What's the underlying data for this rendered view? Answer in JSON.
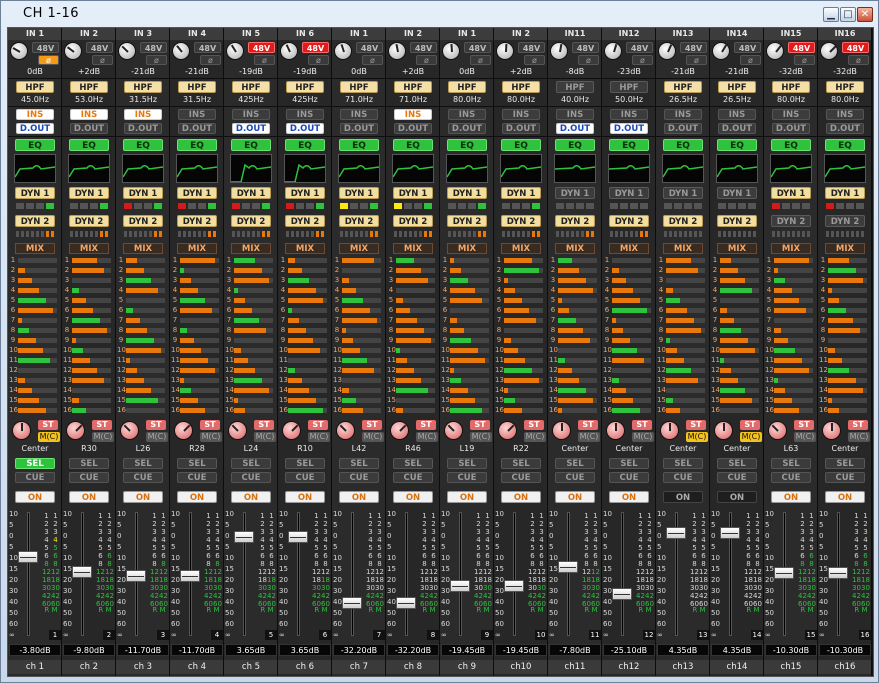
{
  "window": {
    "title": "CH 1-16"
  },
  "colors": {
    "sel_on": "#2fc33d",
    "phantom_on": "#e01b1b",
    "dyn_on": "#f2de9f",
    "mix_bus": "#f0a66a",
    "on_text": "#d9710c"
  },
  "channels": [
    {
      "input": "IN 1",
      "p48": "48V",
      "p48_on": false,
      "phase_on": true,
      "gain": "0dB",
      "hpf_on": true,
      "freq": "45.0Hz",
      "ins": "INS",
      "ins_on": true,
      "dout": "D.OUT",
      "dout_on": true,
      "eq": "EQ",
      "dyn1": "DYN 1",
      "dyn1_on": true,
      "dyn2": "DYN 2",
      "dyn2_on": true,
      "mix": "MIX",
      "pan": "Center",
      "st": "ST",
      "mc": "M(C)",
      "mc_on": true,
      "sel": "SEL",
      "sel_on": true,
      "cue": "CUE",
      "on": "ON",
      "on_state": true,
      "fader": "-3.80dB",
      "fader_pos": 0.35,
      "meter": [
        0.55,
        0.8
      ],
      "chnum": "1",
      "name": "ch 1"
    },
    {
      "input": "IN 2",
      "p48": "48V",
      "p48_on": false,
      "phase_on": false,
      "gain": "+2dB",
      "hpf_on": true,
      "freq": "53.0Hz",
      "ins": "INS",
      "ins_on": true,
      "dout": "D.OUT",
      "dout_on": false,
      "eq": "EQ",
      "dyn1": "DYN 1",
      "dyn1_on": true,
      "dyn2": "DYN 2",
      "dyn2_on": true,
      "mix": "MIX",
      "pan": "R30",
      "st": "ST",
      "mc": "M(C)",
      "mc_on": false,
      "sel": "SEL",
      "sel_on": false,
      "cue": "CUE",
      "on": "ON",
      "on_state": true,
      "fader": "-9.80dB",
      "fader_pos": 0.48,
      "meter": [
        0.45,
        0.6
      ],
      "chnum": "2",
      "name": "ch 2"
    },
    {
      "input": "IN 3",
      "p48": "48V",
      "p48_on": false,
      "phase_on": false,
      "gain": "-21dB",
      "hpf_on": true,
      "freq": "31.5Hz",
      "ins": "INS",
      "ins_on": true,
      "dout": "D.OUT",
      "dout_on": false,
      "eq": "EQ",
      "dyn1": "DYN 1",
      "dyn1_on": true,
      "dyn2": "DYN 2",
      "dyn2_on": true,
      "mix": "MIX",
      "pan": "L26",
      "st": "ST",
      "mc": "M(C)",
      "mc_on": false,
      "sel": "SEL",
      "sel_on": false,
      "cue": "CUE",
      "on": "ON",
      "on_state": true,
      "fader": "-11.70dB",
      "fader_pos": 0.52,
      "meter": [
        0.5,
        0.55
      ],
      "chnum": "3",
      "name": "ch 3"
    },
    {
      "input": "IN 4",
      "p48": "48V",
      "p48_on": false,
      "phase_on": false,
      "gain": "-21dB",
      "hpf_on": true,
      "freq": "31.5Hz",
      "ins": "INS",
      "ins_on": false,
      "dout": "D.OUT",
      "dout_on": false,
      "eq": "EQ",
      "dyn1": "DYN 1",
      "dyn1_on": true,
      "dyn2": "DYN 2",
      "dyn2_on": true,
      "mix": "MIX",
      "pan": "R28",
      "st": "ST",
      "mc": "M(C)",
      "mc_on": false,
      "sel": "SEL",
      "sel_on": false,
      "cue": "CUE",
      "on": "ON",
      "on_state": true,
      "fader": "-11.70dB",
      "fader_pos": 0.52,
      "meter": [
        0.5,
        0.55
      ],
      "chnum": "4",
      "name": "ch 4"
    },
    {
      "input": "IN 5",
      "p48": "48V",
      "p48_on": true,
      "phase_on": false,
      "gain": "-19dB",
      "hpf_on": true,
      "freq": "425Hz",
      "ins": "INS",
      "ins_on": false,
      "dout": "D.OUT",
      "dout_on": true,
      "eq": "EQ",
      "dyn1": "DYN 1",
      "dyn1_on": true,
      "dyn2": "DYN 2",
      "dyn2_on": true,
      "mix": "MIX",
      "pan": "L24",
      "st": "ST",
      "mc": "M(C)",
      "mc_on": false,
      "sel": "SEL",
      "sel_on": false,
      "cue": "CUE",
      "on": "ON",
      "on_state": true,
      "fader": "3.65dB",
      "fader_pos": 0.17,
      "meter": [
        0.3,
        0.35
      ],
      "chnum": "5",
      "name": "ch 5"
    },
    {
      "input": "IN 6",
      "p48": "48V",
      "p48_on": true,
      "phase_on": false,
      "gain": "-19dB",
      "hpf_on": true,
      "freq": "425Hz",
      "ins": "INS",
      "ins_on": false,
      "dout": "D.OUT",
      "dout_on": true,
      "eq": "EQ",
      "dyn1": "DYN 1",
      "dyn1_on": true,
      "dyn2": "DYN 2",
      "dyn2_on": true,
      "mix": "MIX",
      "pan": "R10",
      "st": "ST",
      "mc": "M(C)",
      "mc_on": false,
      "sel": "SEL",
      "sel_on": false,
      "cue": "CUE",
      "on": "ON",
      "on_state": true,
      "fader": "3.65dB",
      "fader_pos": 0.17,
      "meter": [
        0.3,
        0.35
      ],
      "chnum": "6",
      "name": "ch 6"
    },
    {
      "input": "IN 1",
      "p48": "48V",
      "p48_on": false,
      "phase_on": false,
      "gain": "0dB",
      "hpf_on": true,
      "freq": "71.0Hz",
      "ins": "INS",
      "ins_on": false,
      "dout": "D.OUT",
      "dout_on": false,
      "eq": "EQ",
      "dyn1": "DYN 1",
      "dyn1_on": true,
      "dyn2": "DYN 2",
      "dyn2_on": true,
      "mix": "MIX",
      "pan": "L42",
      "st": "ST",
      "mc": "M(C)",
      "mc_on": false,
      "sel": "SEL",
      "sel_on": false,
      "cue": "CUE",
      "on": "ON",
      "on_state": true,
      "fader": "-32.20dB",
      "fader_pos": 0.76,
      "meter": [
        0.2,
        0.25
      ],
      "chnum": "7",
      "name": "ch 7"
    },
    {
      "input": "IN 2",
      "p48": "48V",
      "p48_on": false,
      "phase_on": false,
      "gain": "+2dB",
      "hpf_on": true,
      "freq": "71.0Hz",
      "ins": "INS",
      "ins_on": true,
      "dout": "D.OUT",
      "dout_on": false,
      "eq": "EQ",
      "dyn1": "DYN 1",
      "dyn1_on": true,
      "dyn2": "DYN 2",
      "dyn2_on": true,
      "mix": "MIX",
      "pan": "R46",
      "st": "ST",
      "mc": "M(C)",
      "mc_on": false,
      "sel": "SEL",
      "sel_on": false,
      "cue": "CUE",
      "on": "ON",
      "on_state": true,
      "fader": "-32.20dB",
      "fader_pos": 0.76,
      "meter": [
        0.2,
        0.25
      ],
      "chnum": "8",
      "name": "ch 8"
    },
    {
      "input": "IN 1",
      "p48": "48V",
      "p48_on": false,
      "phase_on": false,
      "gain": "0dB",
      "hpf_on": true,
      "freq": "80.0Hz",
      "ins": "INS",
      "ins_on": false,
      "dout": "D.OUT",
      "dout_on": false,
      "eq": "EQ",
      "dyn1": "DYN 1",
      "dyn1_on": true,
      "dyn2": "DYN 2",
      "dyn2_on": true,
      "mix": "MIX",
      "pan": "L19",
      "st": "ST",
      "mc": "M(C)",
      "mc_on": false,
      "sel": "SEL",
      "sel_on": false,
      "cue": "CUE",
      "on": "ON",
      "on_state": true,
      "fader": "-19.45dB",
      "fader_pos": 0.61,
      "meter": [
        0.25,
        0.3
      ],
      "chnum": "9",
      "name": "ch 9"
    },
    {
      "input": "IN 2",
      "p48": "48V",
      "p48_on": false,
      "phase_on": false,
      "gain": "+2dB",
      "hpf_on": true,
      "freq": "80.0Hz",
      "ins": "INS",
      "ins_on": false,
      "dout": "D.OUT",
      "dout_on": false,
      "eq": "EQ",
      "dyn1": "DYN 1",
      "dyn1_on": true,
      "dyn2": "DYN 2",
      "dyn2_on": true,
      "mix": "MIX",
      "pan": "R22",
      "st": "ST",
      "mc": "M(C)",
      "mc_on": false,
      "sel": "SEL",
      "sel_on": false,
      "cue": "CUE",
      "on": "ON",
      "on_state": true,
      "fader": "-19.45dB",
      "fader_pos": 0.61,
      "meter": [
        0.25,
        0.3
      ],
      "chnum": "10",
      "name": "ch10"
    },
    {
      "input": "IN11",
      "p48": "48V",
      "p48_on": false,
      "phase_on": false,
      "gain": "-8dB",
      "hpf_on": false,
      "freq": "40.0Hz",
      "ins": "INS",
      "ins_on": false,
      "dout": "D.OUT",
      "dout_on": true,
      "eq": "EQ",
      "dyn1": "DYN 1",
      "dyn1_on": false,
      "dyn2": "DYN 2",
      "dyn2_on": true,
      "mix": "MIX",
      "pan": "Center",
      "st": "ST",
      "mc": "M(C)",
      "mc_on": false,
      "sel": "SEL",
      "sel_on": false,
      "cue": "CUE",
      "on": "ON",
      "on_state": true,
      "fader": "-7.80dB",
      "fader_pos": 0.44,
      "meter": [
        0.4,
        0.45
      ],
      "chnum": "11",
      "name": "ch11"
    },
    {
      "input": "IN12",
      "p48": "48V",
      "p48_on": false,
      "phase_on": false,
      "gain": "-23dB",
      "hpf_on": false,
      "freq": "50.0Hz",
      "ins": "INS",
      "ins_on": false,
      "dout": "D.OUT",
      "dout_on": true,
      "eq": "EQ",
      "dyn1": "DYN 1",
      "dyn1_on": false,
      "dyn2": "DYN 2",
      "dyn2_on": true,
      "mix": "MIX",
      "pan": "Center",
      "st": "ST",
      "mc": "M(C)",
      "mc_on": false,
      "sel": "SEL",
      "sel_on": false,
      "cue": "CUE",
      "on": "ON",
      "on_state": true,
      "fader": "-25.10dB",
      "fader_pos": 0.68,
      "meter": [
        0.2,
        0.2
      ],
      "chnum": "12",
      "name": "ch12"
    },
    {
      "input": "IN13",
      "p48": "48V",
      "p48_on": false,
      "phase_on": false,
      "gain": "-21dB",
      "hpf_on": true,
      "freq": "26.5Hz",
      "ins": "INS",
      "ins_on": false,
      "dout": "D.OUT",
      "dout_on": false,
      "eq": "EQ",
      "dyn1": "DYN 1",
      "dyn1_on": false,
      "dyn2": "DYN 2",
      "dyn2_on": true,
      "mix": "MIX",
      "pan": "Center",
      "st": "ST",
      "mc": "M(C)",
      "mc_on": true,
      "sel": "SEL",
      "sel_on": false,
      "cue": "CUE",
      "on": "ON",
      "on_state": false,
      "fader": "4.35dB",
      "fader_pos": 0.13,
      "meter": [
        0,
        0
      ],
      "chnum": "13",
      "name": "ch13"
    },
    {
      "input": "IN14",
      "p48": "48V",
      "p48_on": false,
      "phase_on": false,
      "gain": "-21dB",
      "hpf_on": true,
      "freq": "26.5Hz",
      "ins": "INS",
      "ins_on": false,
      "dout": "D.OUT",
      "dout_on": false,
      "eq": "EQ",
      "dyn1": "DYN 1",
      "dyn1_on": false,
      "dyn2": "DYN 2",
      "dyn2_on": true,
      "mix": "MIX",
      "pan": "Center",
      "st": "ST",
      "mc": "M(C)",
      "mc_on": true,
      "sel": "SEL",
      "sel_on": false,
      "cue": "CUE",
      "on": "ON",
      "on_state": false,
      "fader": "4.35dB",
      "fader_pos": 0.13,
      "meter": [
        0,
        0
      ],
      "chnum": "14",
      "name": "ch14"
    },
    {
      "input": "IN15",
      "p48": "48V",
      "p48_on": true,
      "phase_on": false,
      "gain": "-32dB",
      "hpf_on": true,
      "freq": "80.0Hz",
      "ins": "INS",
      "ins_on": false,
      "dout": "D.OUT",
      "dout_on": false,
      "eq": "EQ",
      "dyn1": "DYN 1",
      "dyn1_on": true,
      "dyn2": "DYN 2",
      "dyn2_on": false,
      "mix": "MIX",
      "pan": "L63",
      "st": "ST",
      "mc": "M(C)",
      "mc_on": false,
      "sel": "SEL",
      "sel_on": false,
      "cue": "CUE",
      "on": "ON",
      "on_state": true,
      "fader": "-10.30dB",
      "fader_pos": 0.49,
      "meter": [
        0.55,
        0.6
      ],
      "chnum": "15",
      "name": "ch15"
    },
    {
      "input": "IN16",
      "p48": "48V",
      "p48_on": true,
      "phase_on": false,
      "gain": "-32dB",
      "hpf_on": true,
      "freq": "80.0Hz",
      "ins": "INS",
      "ins_on": false,
      "dout": "D.OUT",
      "dout_on": false,
      "eq": "EQ",
      "dyn1": "DYN 1",
      "dyn1_on": true,
      "dyn2": "DYN 2",
      "dyn2_on": false,
      "mix": "MIX",
      "pan": "Center",
      "st": "ST",
      "mc": "M(C)",
      "mc_on": false,
      "sel": "SEL",
      "sel_on": false,
      "cue": "CUE",
      "on": "ON",
      "on_state": true,
      "fader": "-10.30dB",
      "fader_pos": 0.49,
      "meter": [
        0.55,
        0.6
      ],
      "chnum": "16",
      "name": "ch16"
    }
  ],
  "fader_scale": [
    "10",
    "5",
    "0",
    "5",
    "10",
    "15",
    "20",
    "30",
    "40",
    "50",
    "60",
    "∞"
  ],
  "meter_scale": [
    "1",
    "2",
    "3",
    "4",
    "5",
    "6",
    "8",
    "12",
    "18",
    "30",
    "42",
    "60"
  ],
  "meter_footer": "R M"
}
